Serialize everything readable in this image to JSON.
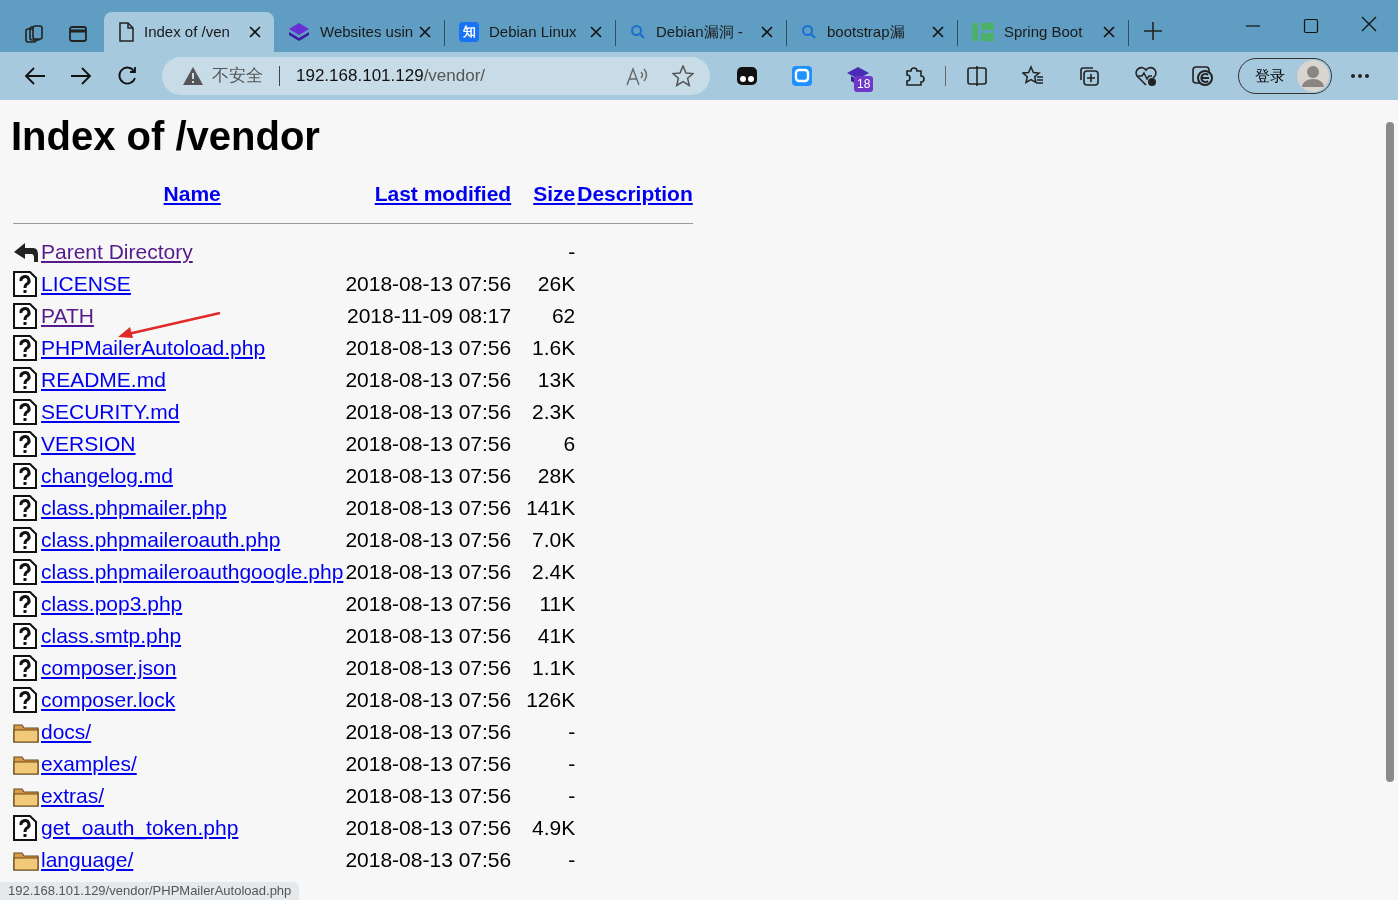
{
  "browser": {
    "tabs": [
      {
        "kind": "page",
        "title": "Index of /ven",
        "selected": true
      },
      {
        "kind": "stack",
        "title": "Websites usin",
        "selected": false
      },
      {
        "kind": "zhihu",
        "glyph": "知",
        "title": "Debian Linux",
        "selected": false
      },
      {
        "kind": "search",
        "title": "Debian漏洞 -",
        "selected": false
      },
      {
        "kind": "search",
        "title": "bootstrap漏",
        "selected": false
      },
      {
        "kind": "spring",
        "title": "Spring Boot",
        "selected": false
      }
    ],
    "address": {
      "security": "不安全",
      "host": "192.168.101.129",
      "path": "/vendor/"
    },
    "extension_badge": "18",
    "sign_in": "登录"
  },
  "page": {
    "heading": "Index of /vendor",
    "columns": [
      "Name",
      "Last modified",
      "Size",
      "Description"
    ],
    "rows": [
      {
        "kind": "parent",
        "name": "Parent Directory",
        "modified": "",
        "size": "-",
        "visited": true
      },
      {
        "kind": "file",
        "name": "LICENSE",
        "modified": "2018-08-13 07:56",
        "size": "26K",
        "visited": false
      },
      {
        "kind": "file",
        "name": "PATH",
        "modified": "2018-11-09 08:17",
        "size": "62",
        "visited": true
      },
      {
        "kind": "file",
        "name": "PHPMailerAutoload.php",
        "modified": "2018-08-13 07:56",
        "size": "1.6K",
        "visited": false
      },
      {
        "kind": "file",
        "name": "README.md",
        "modified": "2018-08-13 07:56",
        "size": "13K",
        "visited": false
      },
      {
        "kind": "file",
        "name": "SECURITY.md",
        "modified": "2018-08-13 07:56",
        "size": "2.3K",
        "visited": false
      },
      {
        "kind": "file",
        "name": "VERSION",
        "modified": "2018-08-13 07:56",
        "size": "6",
        "visited": false
      },
      {
        "kind": "file",
        "name": "changelog.md",
        "modified": "2018-08-13 07:56",
        "size": "28K",
        "visited": false
      },
      {
        "kind": "file",
        "name": "class.phpmailer.php",
        "modified": "2018-08-13 07:56",
        "size": "141K",
        "visited": false
      },
      {
        "kind": "file",
        "name": "class.phpmaileroauth.php",
        "modified": "2018-08-13 07:56",
        "size": "7.0K",
        "visited": false
      },
      {
        "kind": "file",
        "name": "class.phpmaileroauthgoogle.php",
        "modified": "2018-08-13 07:56",
        "size": "2.4K",
        "visited": false
      },
      {
        "kind": "file",
        "name": "class.pop3.php",
        "modified": "2018-08-13 07:56",
        "size": "11K",
        "visited": false
      },
      {
        "kind": "file",
        "name": "class.smtp.php",
        "modified": "2018-08-13 07:56",
        "size": "41K",
        "visited": false
      },
      {
        "kind": "file",
        "name": "composer.json",
        "modified": "2018-08-13 07:56",
        "size": "1.1K",
        "visited": false
      },
      {
        "kind": "file",
        "name": "composer.lock",
        "modified": "2018-08-13 07:56",
        "size": "126K",
        "visited": false
      },
      {
        "kind": "folder",
        "name": "docs/",
        "modified": "2018-08-13 07:56",
        "size": "-",
        "visited": false
      },
      {
        "kind": "folder",
        "name": "examples/",
        "modified": "2018-08-13 07:56",
        "size": "-",
        "visited": false
      },
      {
        "kind": "folder",
        "name": "extras/",
        "modified": "2018-08-13 07:56",
        "size": "-",
        "visited": false
      },
      {
        "kind": "file",
        "name": "get_oauth_token.php",
        "modified": "2018-08-13 07:56",
        "size": "4.9K",
        "visited": false
      },
      {
        "kind": "folder",
        "name": "language/",
        "modified": "2018-08-13 07:56",
        "size": "-",
        "visited": false
      }
    ]
  },
  "status_bar": {
    "link_url": "192.168.101.129/vendor/PHPMailerAutoload.php"
  }
}
